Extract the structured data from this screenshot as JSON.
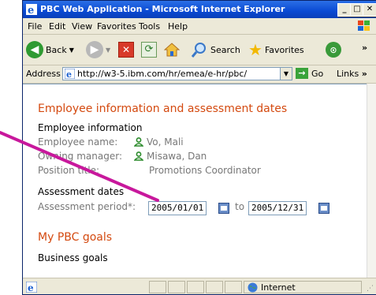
{
  "window": {
    "title": "PBC Web Application - Microsoft Internet Explorer"
  },
  "menu": [
    "File",
    "Edit",
    "View",
    "Favorites",
    "Tools",
    "Help"
  ],
  "toolbar": {
    "back": "Back",
    "search": "Search",
    "favorites": "Favorites"
  },
  "address": {
    "label": "Address",
    "url": "http://w3-5.ibm.com/hr/emea/e-hr/pbc/",
    "go": "Go",
    "links": "Links"
  },
  "page": {
    "heading": "Employee information and assessment dates",
    "employee_section": "Employee information",
    "employee_name_label": "Employee name:",
    "employee_name": "Vo, Mali",
    "owning_manager_label": "Owning manager:",
    "owning_manager": "Misawa, Dan",
    "position_title_label": "Position title:",
    "position_title": "Promotions Coordinator",
    "assessment_section": "Assessment dates",
    "assessment_period_label": "Assessment period*:",
    "start_date": "2005/01/01",
    "to_label": "to",
    "end_date": "2005/12/31",
    "goals_heading": "My PBC goals",
    "business_goals": "Business goals"
  },
  "status": {
    "zone": "Internet"
  },
  "colors": {
    "heading": "#d44a10",
    "pointer": "#c8189c"
  }
}
